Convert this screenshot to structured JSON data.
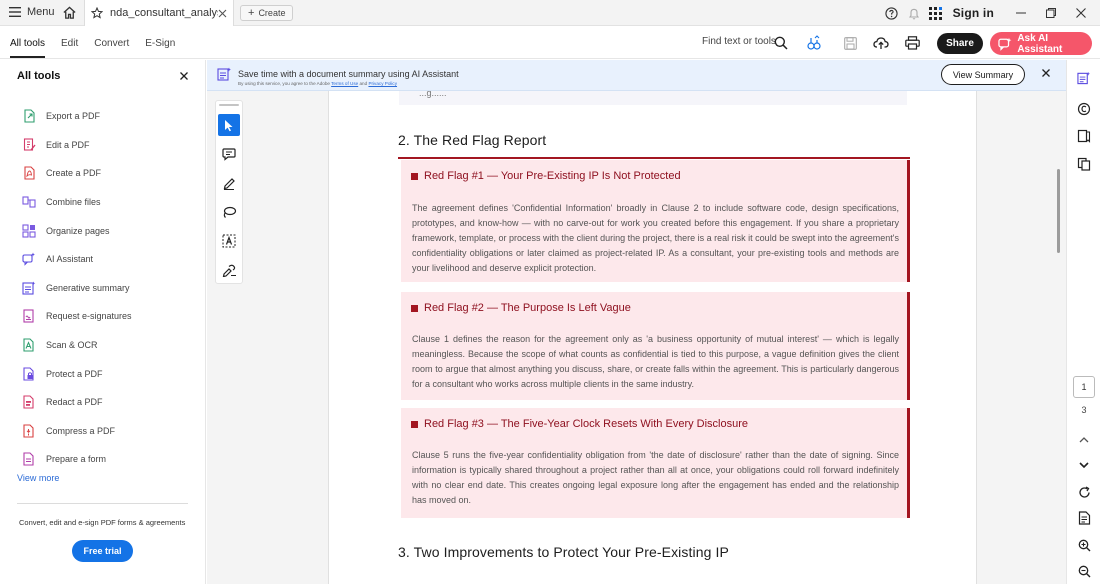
{
  "titlebar": {
    "menu_label": "Menu",
    "tab_title": "nda_consultant_analysis...",
    "create_label": "Create",
    "signin_label": "Sign in"
  },
  "toolbar": {
    "tabs": [
      "All tools",
      "Edit",
      "Convert",
      "E-Sign"
    ],
    "find_label": "Find text or tools",
    "share_label": "Share",
    "ai_label": "Ask AI Assistant"
  },
  "left_panel": {
    "title": "All tools",
    "items": [
      {
        "label": "Export a PDF",
        "icon": "export-pdf-icon"
      },
      {
        "label": "Edit a PDF",
        "icon": "edit-pdf-icon"
      },
      {
        "label": "Create a PDF",
        "icon": "create-pdf-icon"
      },
      {
        "label": "Combine files",
        "icon": "combine-files-icon"
      },
      {
        "label": "Organize pages",
        "icon": "organize-pages-icon"
      },
      {
        "label": "AI Assistant",
        "icon": "ai-assistant-icon"
      },
      {
        "label": "Generative summary",
        "icon": "generative-summary-icon"
      },
      {
        "label": "Request e-signatures",
        "icon": "request-esignatures-icon"
      },
      {
        "label": "Scan & OCR",
        "icon": "scan-ocr-icon"
      },
      {
        "label": "Protect a PDF",
        "icon": "protect-pdf-icon"
      },
      {
        "label": "Redact a PDF",
        "icon": "redact-pdf-icon"
      },
      {
        "label": "Compress a PDF",
        "icon": "compress-pdf-icon"
      },
      {
        "label": "Prepare a form",
        "icon": "prepare-form-icon"
      }
    ],
    "view_more": "View more",
    "promo_text": "Convert, edit and e-sign PDF forms & agreements",
    "trial_label": "Free trial"
  },
  "banner": {
    "text": "Save time with a document summary using AI Assistant",
    "sub_prefix": "By using this service, you agree to the Adobe",
    "sub_terms": "Terms of Use",
    "sub_and": "and",
    "sub_privacy": "Privacy Policy",
    "button_label": "View Summary"
  },
  "document": {
    "top_snippet": "...g......",
    "section2_title": "2. The Red Flag Report",
    "flags": [
      {
        "title": "Red Flag #1 — Your Pre-Existing IP Is Not Protected",
        "body": "The agreement defines 'Confidential Information' broadly in Clause 2 to include software code, design specifications, prototypes, and know-how — with no carve-out for work you created before this engagement. If you share a proprietary framework, template, or process with the client during the project, there is a real risk it could be swept into the agreement's confidentiality obligations or later claimed as project-related IP. As a consultant, your pre-existing tools and methods are your livelihood and deserve explicit protection."
      },
      {
        "title": "Red Flag #2 — The Purpose Is Left Vague",
        "body": "Clause 1 defines the reason for the agreement only as 'a business opportunity of mutual interest' — which is legally meaningless. Because the scope of what counts as confidential is tied to this purpose, a vague definition gives the client room to argue that almost anything you discuss, share, or create falls within the agreement. This is particularly dangerous for a consultant who works across multiple clients in the same industry."
      },
      {
        "title": "Red Flag #3 — The Five-Year Clock Resets With Every Disclosure",
        "body": "Clause 5 runs the five-year confidentiality obligation from 'the date of disclosure' rather than the date of signing. Since information is typically shared throughout a project rather than all at once, your obligations could roll forward indefinitely with no clear end date. This creates ongoing legal exposure long after the engagement has ended and the relationship has moved on."
      }
    ],
    "section3_title": "3. Two Improvements to Protect Your Pre-Existing IP"
  },
  "pager": {
    "current": "1",
    "total": "3"
  },
  "colors": {
    "accent_red": "#a31621",
    "flag_bg": "#fde8eb",
    "ai_button": "#f5566a",
    "primary_blue": "#1473e6"
  }
}
